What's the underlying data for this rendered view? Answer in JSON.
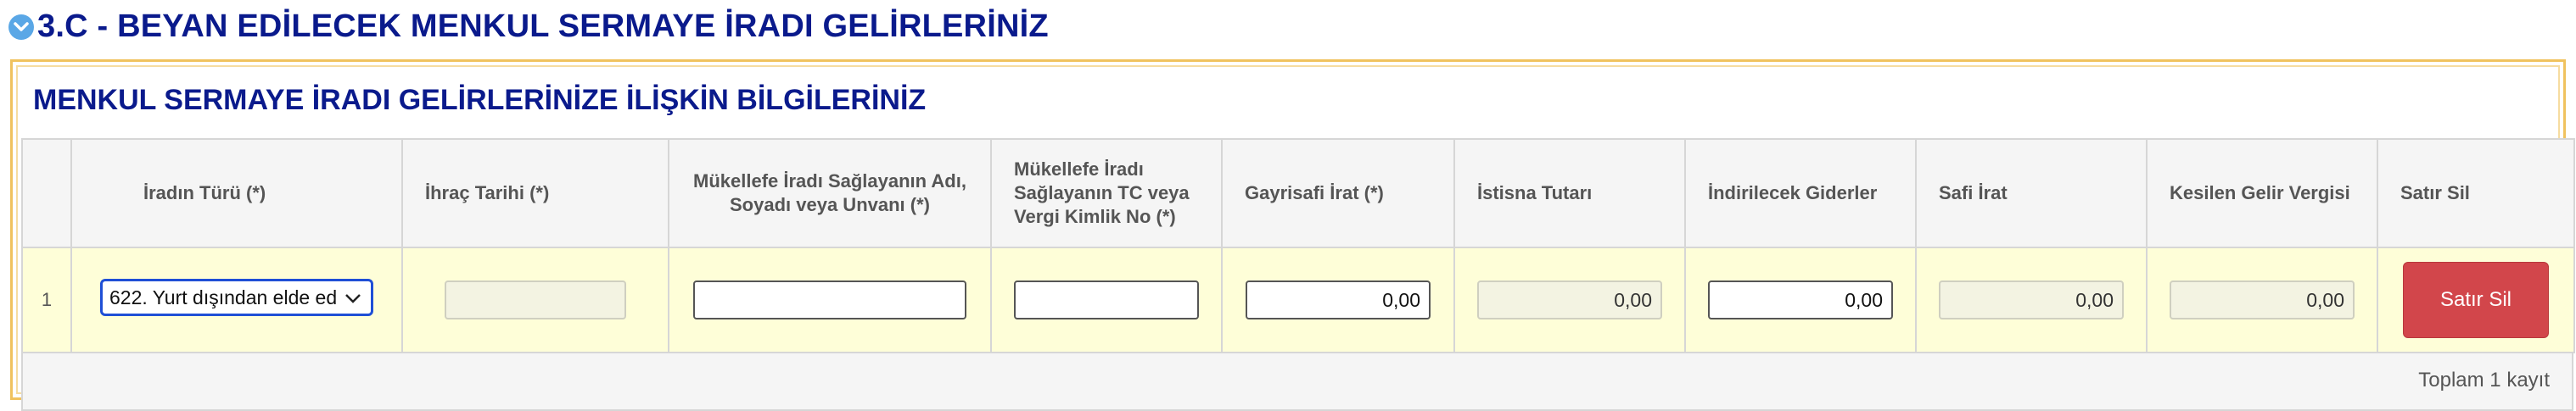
{
  "section": {
    "title": "3.C - BEYAN EDİLECEK MENKUL SERMAYE İRADI GELİRLERİNİZ",
    "toggle_icon": "chevron-down-circle-icon"
  },
  "panel": {
    "title": "MENKUL SERMAYE İRADI GELİRLERİNİZE İLİŞKİN BİLGİLERİNİZ"
  },
  "table": {
    "headers": [
      "",
      "İradın Türü (*)",
      "İhraç Tarihi (*)",
      "Mükellefe İradı Sağlayanın Adı, Soyadı veya Unvanı (*)",
      "Mükellefe İradı Sağlayanın TC veya Vergi Kimlik No (*)",
      "Gayrisafi İrat (*)",
      "İstisna Tutarı",
      "İndirilecek Giderler",
      "Safi İrat",
      "Kesilen Gelir Vergisi",
      "Satır Sil"
    ],
    "rows": [
      {
        "no": "1",
        "irat_turu": "622. Yurt dışından elde ed",
        "ihrac_tarihi": "",
        "saglayan_adi": "",
        "saglayan_tc": "",
        "gayrisafi_irat": "0,00",
        "istisna_tutari": "0,00",
        "indirilecek_giderler": "0,00",
        "safi_irat": "0,00",
        "kesilen_gelir_vergisi": "0,00",
        "delete_label": "Satır Sil"
      }
    ],
    "footer": "Toplam 1 kayıt"
  },
  "colors": {
    "title_blue": "#0a1a8c",
    "panel_border": "#f0c25e",
    "row_bg": "#fefed8",
    "delete_button": "#d2464b",
    "select_focus": "#1f4fd6"
  }
}
